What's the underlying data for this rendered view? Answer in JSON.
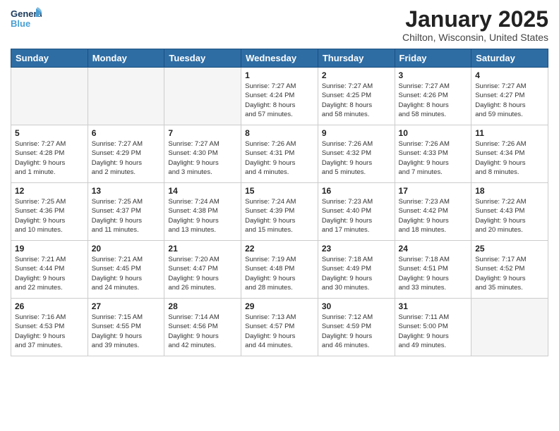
{
  "header": {
    "logo_general": "General",
    "logo_blue": "Blue",
    "month_title": "January 2025",
    "location": "Chilton, Wisconsin, United States"
  },
  "weekdays": [
    "Sunday",
    "Monday",
    "Tuesday",
    "Wednesday",
    "Thursday",
    "Friday",
    "Saturday"
  ],
  "weeks": [
    [
      {
        "day": "",
        "info": ""
      },
      {
        "day": "",
        "info": ""
      },
      {
        "day": "",
        "info": ""
      },
      {
        "day": "1",
        "info": "Sunrise: 7:27 AM\nSunset: 4:24 PM\nDaylight: 8 hours\nand 57 minutes."
      },
      {
        "day": "2",
        "info": "Sunrise: 7:27 AM\nSunset: 4:25 PM\nDaylight: 8 hours\nand 58 minutes."
      },
      {
        "day": "3",
        "info": "Sunrise: 7:27 AM\nSunset: 4:26 PM\nDaylight: 8 hours\nand 58 minutes."
      },
      {
        "day": "4",
        "info": "Sunrise: 7:27 AM\nSunset: 4:27 PM\nDaylight: 8 hours\nand 59 minutes."
      }
    ],
    [
      {
        "day": "5",
        "info": "Sunrise: 7:27 AM\nSunset: 4:28 PM\nDaylight: 9 hours\nand 1 minute."
      },
      {
        "day": "6",
        "info": "Sunrise: 7:27 AM\nSunset: 4:29 PM\nDaylight: 9 hours\nand 2 minutes."
      },
      {
        "day": "7",
        "info": "Sunrise: 7:27 AM\nSunset: 4:30 PM\nDaylight: 9 hours\nand 3 minutes."
      },
      {
        "day": "8",
        "info": "Sunrise: 7:26 AM\nSunset: 4:31 PM\nDaylight: 9 hours\nand 4 minutes."
      },
      {
        "day": "9",
        "info": "Sunrise: 7:26 AM\nSunset: 4:32 PM\nDaylight: 9 hours\nand 5 minutes."
      },
      {
        "day": "10",
        "info": "Sunrise: 7:26 AM\nSunset: 4:33 PM\nDaylight: 9 hours\nand 7 minutes."
      },
      {
        "day": "11",
        "info": "Sunrise: 7:26 AM\nSunset: 4:34 PM\nDaylight: 9 hours\nand 8 minutes."
      }
    ],
    [
      {
        "day": "12",
        "info": "Sunrise: 7:25 AM\nSunset: 4:36 PM\nDaylight: 9 hours\nand 10 minutes."
      },
      {
        "day": "13",
        "info": "Sunrise: 7:25 AM\nSunset: 4:37 PM\nDaylight: 9 hours\nand 11 minutes."
      },
      {
        "day": "14",
        "info": "Sunrise: 7:24 AM\nSunset: 4:38 PM\nDaylight: 9 hours\nand 13 minutes."
      },
      {
        "day": "15",
        "info": "Sunrise: 7:24 AM\nSunset: 4:39 PM\nDaylight: 9 hours\nand 15 minutes."
      },
      {
        "day": "16",
        "info": "Sunrise: 7:23 AM\nSunset: 4:40 PM\nDaylight: 9 hours\nand 17 minutes."
      },
      {
        "day": "17",
        "info": "Sunrise: 7:23 AM\nSunset: 4:42 PM\nDaylight: 9 hours\nand 18 minutes."
      },
      {
        "day": "18",
        "info": "Sunrise: 7:22 AM\nSunset: 4:43 PM\nDaylight: 9 hours\nand 20 minutes."
      }
    ],
    [
      {
        "day": "19",
        "info": "Sunrise: 7:21 AM\nSunset: 4:44 PM\nDaylight: 9 hours\nand 22 minutes."
      },
      {
        "day": "20",
        "info": "Sunrise: 7:21 AM\nSunset: 4:45 PM\nDaylight: 9 hours\nand 24 minutes."
      },
      {
        "day": "21",
        "info": "Sunrise: 7:20 AM\nSunset: 4:47 PM\nDaylight: 9 hours\nand 26 minutes."
      },
      {
        "day": "22",
        "info": "Sunrise: 7:19 AM\nSunset: 4:48 PM\nDaylight: 9 hours\nand 28 minutes."
      },
      {
        "day": "23",
        "info": "Sunrise: 7:18 AM\nSunset: 4:49 PM\nDaylight: 9 hours\nand 30 minutes."
      },
      {
        "day": "24",
        "info": "Sunrise: 7:18 AM\nSunset: 4:51 PM\nDaylight: 9 hours\nand 33 minutes."
      },
      {
        "day": "25",
        "info": "Sunrise: 7:17 AM\nSunset: 4:52 PM\nDaylight: 9 hours\nand 35 minutes."
      }
    ],
    [
      {
        "day": "26",
        "info": "Sunrise: 7:16 AM\nSunset: 4:53 PM\nDaylight: 9 hours\nand 37 minutes."
      },
      {
        "day": "27",
        "info": "Sunrise: 7:15 AM\nSunset: 4:55 PM\nDaylight: 9 hours\nand 39 minutes."
      },
      {
        "day": "28",
        "info": "Sunrise: 7:14 AM\nSunset: 4:56 PM\nDaylight: 9 hours\nand 42 minutes."
      },
      {
        "day": "29",
        "info": "Sunrise: 7:13 AM\nSunset: 4:57 PM\nDaylight: 9 hours\nand 44 minutes."
      },
      {
        "day": "30",
        "info": "Sunrise: 7:12 AM\nSunset: 4:59 PM\nDaylight: 9 hours\nand 46 minutes."
      },
      {
        "day": "31",
        "info": "Sunrise: 7:11 AM\nSunset: 5:00 PM\nDaylight: 9 hours\nand 49 minutes."
      },
      {
        "day": "",
        "info": ""
      }
    ]
  ]
}
